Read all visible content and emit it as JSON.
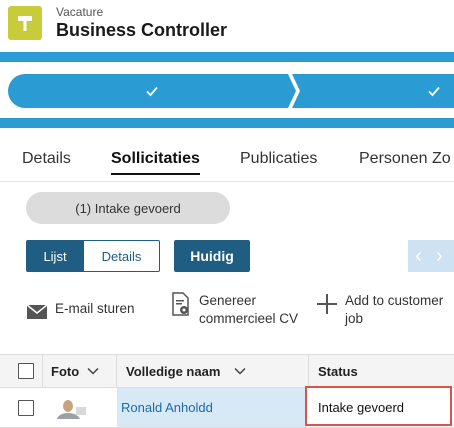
{
  "header": {
    "record_type": "Vacature",
    "title": "Business Controller",
    "app_icon": "hammer-icon",
    "app_icon_color": "#c9cc3a"
  },
  "path": {
    "stages": [
      {
        "state": "completed",
        "icon": "check-icon"
      },
      {
        "state": "completed",
        "icon": "check-icon"
      }
    ],
    "color": "#2b9bd3"
  },
  "tabs": [
    {
      "label": "Details",
      "active": false
    },
    {
      "label": "Sollicitaties",
      "active": true
    },
    {
      "label": "Publicaties",
      "active": false
    },
    {
      "label": "Personen Zo",
      "active": false
    }
  ],
  "filter": {
    "label": "(1) Intake gevoerd"
  },
  "view": {
    "list_label": "Lijst",
    "details_label": "Details",
    "current_label": "Huidig",
    "accent": "#1f5d82"
  },
  "actions": [
    {
      "label": "E-mail sturen",
      "icon": "envelope-icon"
    },
    {
      "label_line1": "Genereer",
      "label_line2": "commercieel CV",
      "icon": "document-gear-icon"
    },
    {
      "label_line1": "Add to customer",
      "label_line2": "job",
      "icon": "plus-icon"
    }
  ],
  "table": {
    "columns": [
      "Foto",
      "Volledige naam",
      "Status"
    ],
    "rows": [
      {
        "name": "Ronald Anholdd",
        "status": "Intake gevoerd",
        "photo": "avatar-photo"
      }
    ],
    "highlight_color": "#d9534f"
  }
}
